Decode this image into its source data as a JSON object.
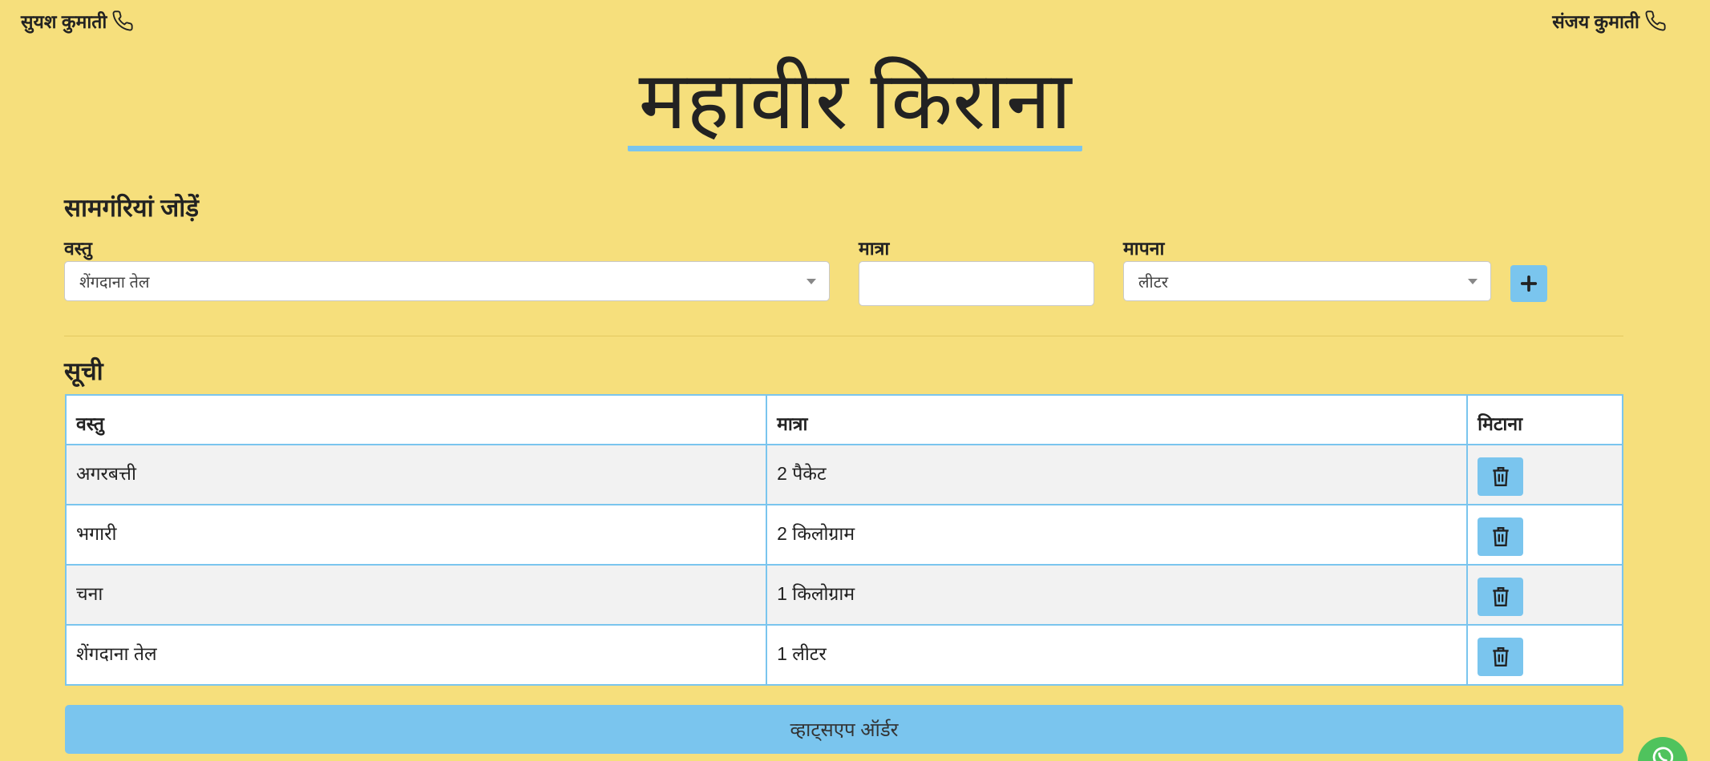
{
  "contacts": {
    "left": {
      "name": "सुयश कुमाती",
      "icon": "phone-icon"
    },
    "right": {
      "name": "संजय कुमाती",
      "icon": "phone-icon"
    }
  },
  "title": "महावीर किराना",
  "add_section": {
    "heading": "सामगंरियां जोड़ें",
    "item_label": "वस्तु",
    "item_value": "शेंगदाना तेल",
    "qty_label": "मात्रा",
    "qty_value": "",
    "unit_label": "मापना",
    "unit_value": "लीटर",
    "add_icon": "plus-icon"
  },
  "list_section": {
    "heading": "सूची",
    "columns": [
      "वस्तु",
      "मात्रा",
      "मिटाना"
    ],
    "rows": [
      {
        "item": "अगरबत्ती",
        "qty": "2 पैकेट"
      },
      {
        "item": "भगारी",
        "qty": "2 किलोग्राम"
      },
      {
        "item": "चना",
        "qty": "1 किलोग्राम"
      },
      {
        "item": "शेंगदाना तेल",
        "qty": "1 लीटर"
      }
    ],
    "delete_icon": "trash-icon"
  },
  "order_button": "व्हाट्सएप ऑर्डर",
  "whatsapp_fab_icon": "whatsapp-icon",
  "colors": {
    "background": "#f6df7c",
    "accent": "#7ac5ee",
    "table_border": "#7ac5ee",
    "fab": "#4fc35d"
  }
}
